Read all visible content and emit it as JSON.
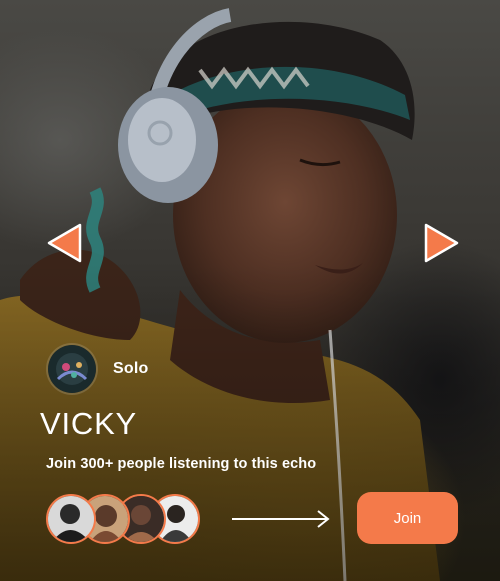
{
  "host": {
    "name": "Solo",
    "avatar_icon": "host-avatar"
  },
  "echo": {
    "title": "VICKY",
    "subtitle": "Join 300+ people listening to this echo"
  },
  "listeners": [
    {
      "icon": "listener-avatar"
    },
    {
      "icon": "listener-avatar"
    },
    {
      "icon": "listener-avatar"
    },
    {
      "icon": "listener-avatar"
    }
  ],
  "join_button": {
    "label": "Join"
  },
  "navigation": {
    "previous_icon": "triangle-left-icon",
    "next_icon": "triangle-right-icon"
  },
  "colors": {
    "accent": "#f47a4a",
    "text": "#ffffff"
  }
}
